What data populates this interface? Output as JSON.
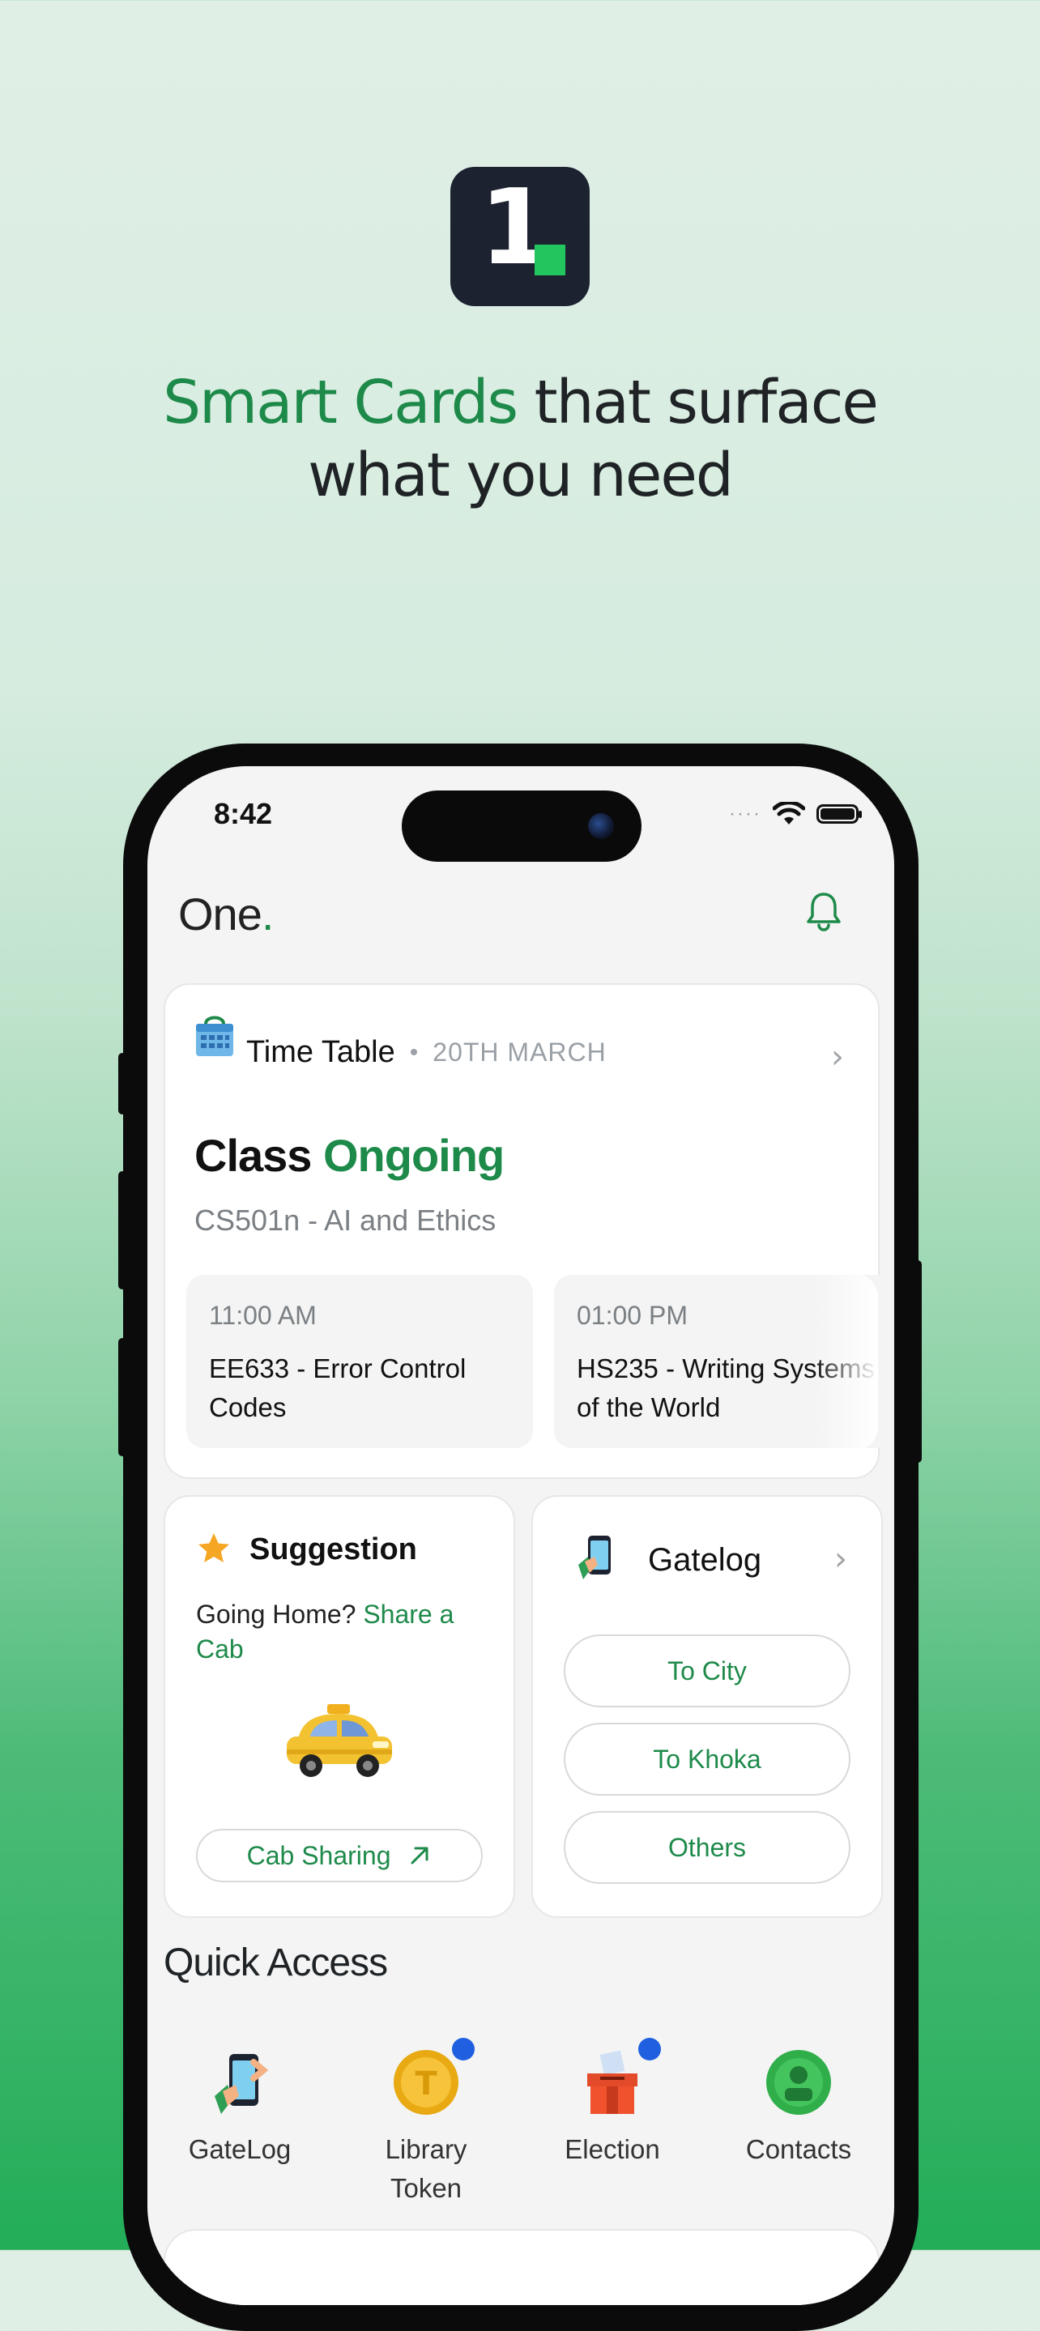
{
  "promo": {
    "logo_digit": "1",
    "headline_green": "Smart Cards",
    "headline_rest_line1": " that surface",
    "headline_line2": "what you need"
  },
  "status_bar": {
    "time": "8:42"
  },
  "header": {
    "brand": "One",
    "brand_dot": "."
  },
  "timetable_card": {
    "title": "Time Table",
    "separator": "•",
    "date": "20TH MARCH",
    "status_prefix": "Class",
    "status_value": "Ongoing",
    "current_course": "CS501n - AI and Ethics",
    "slots": [
      {
        "time": "11:00 AM",
        "course": "EE633 - Error Control Codes"
      },
      {
        "time": "01:00 PM",
        "course": "HS235 - Writing Systems of the World"
      }
    ]
  },
  "suggestion_card": {
    "title": "Suggestion",
    "text": "Going Home?",
    "link": "Share a Cab",
    "button": "Cab Sharing"
  },
  "gatelog_card": {
    "title": "Gatelog",
    "options": [
      "To City",
      "To Khoka",
      "Others"
    ]
  },
  "quick_access": {
    "title": "Quick Access",
    "items": [
      {
        "label": "GateLog",
        "has_notification": false
      },
      {
        "label": "Library Token",
        "has_notification": true
      },
      {
        "label": "Election",
        "has_notification": true
      },
      {
        "label": "Contacts",
        "has_notification": false
      }
    ]
  },
  "colors": {
    "accent_green": "#1e8a4a",
    "notification_blue": "#1f5fe0",
    "dark": "#1d2230"
  }
}
